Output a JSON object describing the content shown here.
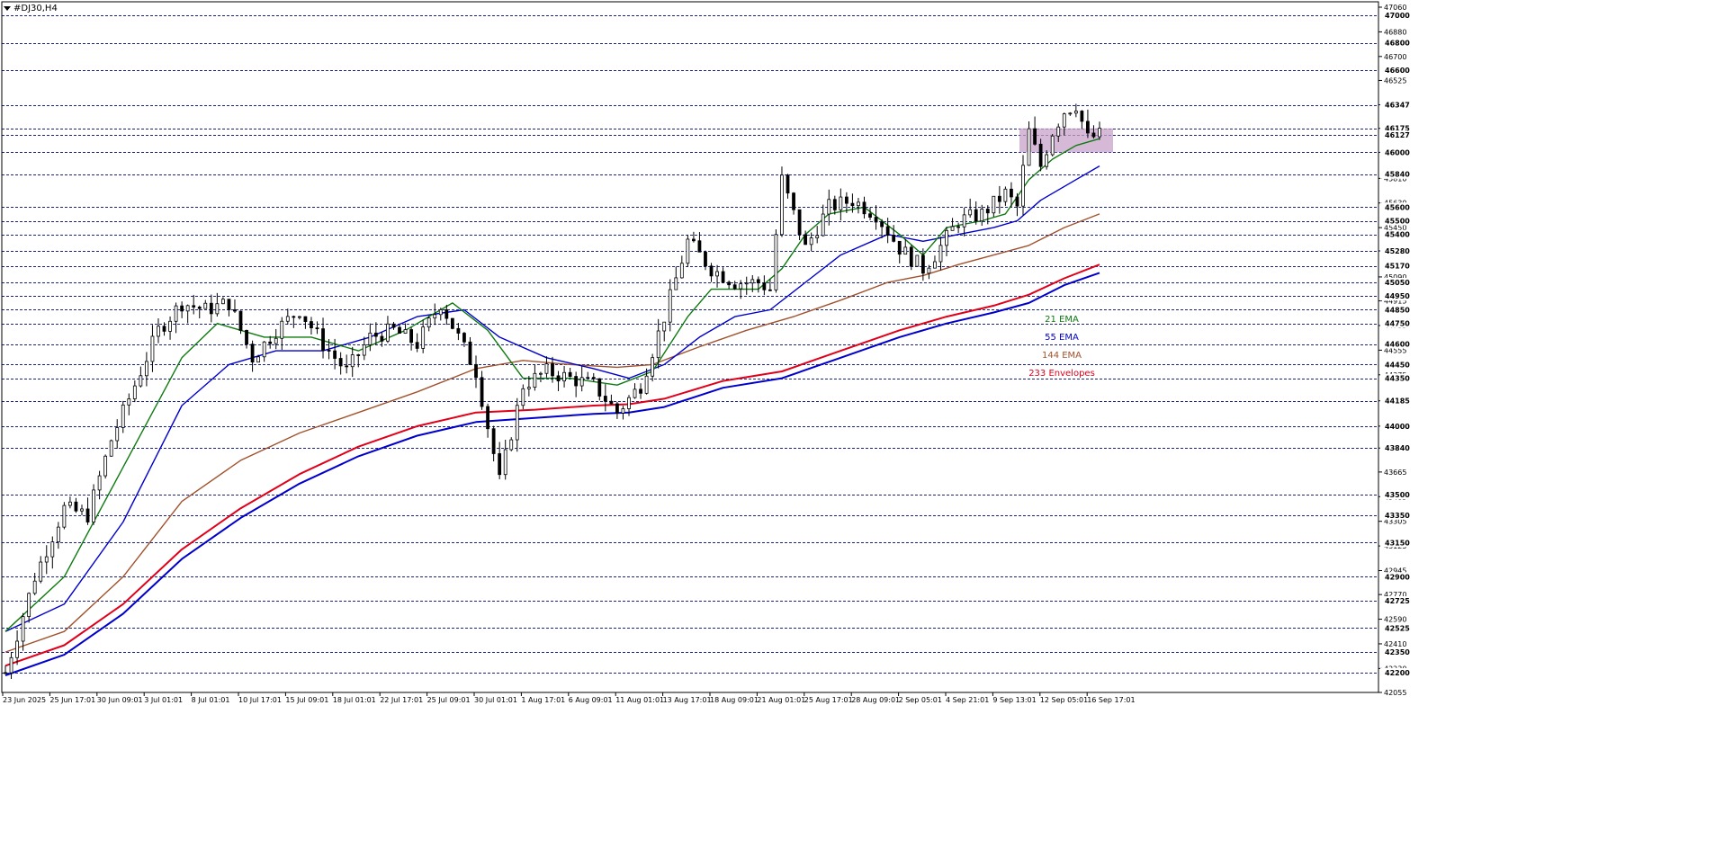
{
  "window": {
    "title": "#DJ30,H4"
  },
  "colors": {
    "ema21": "#0f7a0f",
    "ema55": "#0000cc",
    "ema144": "#a0522d",
    "envelope_upper": "#e0001a",
    "envelope_lower": "#0000cc",
    "grid": "#1a237e",
    "candle": "#000000",
    "highlight": "#c8a2c8"
  },
  "chart_data": {
    "type": "line",
    "symbol": "#DJ30",
    "timeframe": "H4",
    "title": "#DJ30,H4",
    "ylim": [
      42055,
      47060
    ],
    "y_tick_labels": [
      "47060",
      "46880",
      "46700",
      "46525",
      "46347",
      "46175",
      "46000",
      "45810",
      "45630",
      "45450",
      "45280",
      "45090",
      "44915",
      "44735",
      "44555",
      "44375",
      "44185",
      "44000",
      "43840",
      "43665",
      "43485",
      "43305",
      "43125",
      "42945",
      "42770",
      "42590",
      "42410",
      "42230",
      "42055"
    ],
    "price_levels": [
      47000,
      46800,
      46600,
      46347,
      46175,
      46127,
      46000,
      45840,
      45600,
      45500,
      45400,
      45280,
      45170,
      45050,
      44950,
      44850,
      44750,
      44600,
      44450,
      44350,
      44185,
      44000,
      43840,
      43500,
      43350,
      43150,
      42900,
      42725,
      42525,
      42350,
      42200
    ],
    "highlighted_levels": [
      "46175",
      "46127",
      "46000"
    ],
    "current_price": "46127",
    "x_tick_labels": [
      "23 Jun 2025",
      "25 Jun 17:01",
      "30 Jun 09:01",
      "3 Jul 01:01",
      "8 Jul 01:01",
      "10 Jul 17:01",
      "15 Jul 09:01",
      "18 Jul 01:01",
      "22 Jul 17:01",
      "25 Jul 09:01",
      "30 Jul 01:01",
      "1 Aug 17:01",
      "6 Aug 09:01",
      "11 Aug 01:01",
      "13 Aug 17:01",
      "18 Aug 09:01",
      "21 Aug 01:01",
      "25 Aug 17:01",
      "28 Aug 09:01",
      "2 Sep 05:01",
      "4 Sep 21:01",
      "9 Sep 13:01",
      "12 Sep 05:01",
      "16 Sep 17:01"
    ],
    "legend": [
      {
        "name": "21 EMA",
        "color": "#0f7a0f"
      },
      {
        "name": "55 EMA",
        "color": "#0000cc"
      },
      {
        "name": "144 EMA",
        "color": "#a0522d"
      },
      {
        "name": "233 Envelopes",
        "color": "#e0001a"
      }
    ],
    "zone": {
      "from_x": "12 Sep 05:01",
      "to_x": "16 Sep 17:01",
      "y_low": 46000,
      "y_high": 46175
    },
    "price_path": [
      [
        0,
        42200
      ],
      [
        5,
        42900
      ],
      [
        10,
        43400
      ],
      [
        14,
        43350
      ],
      [
        18,
        43900
      ],
      [
        22,
        44300
      ],
      [
        26,
        44700
      ],
      [
        30,
        44900
      ],
      [
        34,
        44850
      ],
      [
        38,
        44900
      ],
      [
        42,
        44500
      ],
      [
        46,
        44700
      ],
      [
        50,
        44850
      ],
      [
        54,
        44600
      ],
      [
        58,
        44400
      ],
      [
        62,
        44650
      ],
      [
        66,
        44700
      ],
      [
        70,
        44600
      ],
      [
        74,
        44900
      ],
      [
        80,
        44400
      ],
      [
        84,
        43600
      ],
      [
        88,
        44300
      ],
      [
        92,
        44400
      ],
      [
        96,
        44350
      ],
      [
        100,
        44300
      ],
      [
        104,
        44100
      ],
      [
        108,
        44300
      ],
      [
        112,
        44800
      ],
      [
        116,
        45350
      ],
      [
        120,
        45150
      ],
      [
        124,
        45050
      ],
      [
        128,
        45050
      ],
      [
        130,
        45000
      ],
      [
        132,
        45800
      ],
      [
        136,
        45300
      ],
      [
        140,
        45600
      ],
      [
        144,
        45650
      ],
      [
        148,
        45550
      ],
      [
        152,
        45300
      ],
      [
        156,
        45150
      ],
      [
        158,
        45250
      ],
      [
        162,
        45500
      ],
      [
        166,
        45550
      ],
      [
        170,
        45700
      ],
      [
        172,
        45600
      ],
      [
        174,
        46150
      ],
      [
        176,
        45900
      ],
      [
        178,
        46150
      ],
      [
        180,
        46300
      ],
      [
        182,
        46350
      ],
      [
        184,
        46100
      ],
      [
        186,
        46127
      ]
    ],
    "ema21": [
      [
        0,
        42500
      ],
      [
        10,
        42900
      ],
      [
        20,
        43700
      ],
      [
        30,
        44500
      ],
      [
        36,
        44750
      ],
      [
        44,
        44650
      ],
      [
        52,
        44650
      ],
      [
        60,
        44550
      ],
      [
        68,
        44700
      ],
      [
        76,
        44900
      ],
      [
        82,
        44700
      ],
      [
        88,
        44350
      ],
      [
        96,
        44350
      ],
      [
        104,
        44300
      ],
      [
        110,
        44400
      ],
      [
        116,
        44800
      ],
      [
        120,
        45000
      ],
      [
        128,
        45000
      ],
      [
        132,
        45150
      ],
      [
        136,
        45400
      ],
      [
        140,
        45550
      ],
      [
        146,
        45600
      ],
      [
        152,
        45400
      ],
      [
        156,
        45250
      ],
      [
        160,
        45450
      ],
      [
        166,
        45500
      ],
      [
        170,
        45550
      ],
      [
        174,
        45800
      ],
      [
        178,
        45950
      ],
      [
        182,
        46050
      ],
      [
        186,
        46100
      ]
    ],
    "ema55": [
      [
        0,
        42500
      ],
      [
        10,
        42700
      ],
      [
        20,
        43300
      ],
      [
        30,
        44150
      ],
      [
        38,
        44450
      ],
      [
        46,
        44550
      ],
      [
        54,
        44550
      ],
      [
        62,
        44650
      ],
      [
        70,
        44800
      ],
      [
        78,
        44850
      ],
      [
        84,
        44650
      ],
      [
        92,
        44500
      ],
      [
        100,
        44420
      ],
      [
        106,
        44350
      ],
      [
        112,
        44450
      ],
      [
        118,
        44650
      ],
      [
        124,
        44800
      ],
      [
        130,
        44850
      ],
      [
        136,
        45050
      ],
      [
        142,
        45250
      ],
      [
        150,
        45400
      ],
      [
        156,
        45350
      ],
      [
        162,
        45400
      ],
      [
        168,
        45450
      ],
      [
        172,
        45500
      ],
      [
        176,
        45650
      ],
      [
        182,
        45800
      ],
      [
        186,
        45900
      ]
    ],
    "ema144": [
      [
        0,
        42350
      ],
      [
        10,
        42500
      ],
      [
        20,
        42900
      ],
      [
        30,
        43450
      ],
      [
        40,
        43750
      ],
      [
        50,
        43950
      ],
      [
        60,
        44100
      ],
      [
        70,
        44250
      ],
      [
        80,
        44420
      ],
      [
        88,
        44480
      ],
      [
        96,
        44450
      ],
      [
        104,
        44430
      ],
      [
        110,
        44450
      ],
      [
        118,
        44580
      ],
      [
        126,
        44700
      ],
      [
        134,
        44800
      ],
      [
        142,
        44920
      ],
      [
        150,
        45050
      ],
      [
        156,
        45100
      ],
      [
        162,
        45180
      ],
      [
        168,
        45250
      ],
      [
        174,
        45320
      ],
      [
        180,
        45450
      ],
      [
        186,
        45550
      ]
    ],
    "envelope_upper": [
      [
        0,
        42250
      ],
      [
        10,
        42400
      ],
      [
        20,
        42700
      ],
      [
        30,
        43100
      ],
      [
        40,
        43400
      ],
      [
        50,
        43650
      ],
      [
        60,
        43850
      ],
      [
        70,
        44000
      ],
      [
        80,
        44100
      ],
      [
        90,
        44120
      ],
      [
        100,
        44150
      ],
      [
        106,
        44160
      ],
      [
        112,
        44200
      ],
      [
        122,
        44330
      ],
      [
        132,
        44400
      ],
      [
        142,
        44550
      ],
      [
        152,
        44700
      ],
      [
        160,
        44800
      ],
      [
        168,
        44880
      ],
      [
        174,
        44960
      ],
      [
        180,
        45080
      ],
      [
        186,
        45180
      ]
    ],
    "envelope_lower": [
      [
        0,
        42180
      ],
      [
        10,
        42330
      ],
      [
        20,
        42630
      ],
      [
        30,
        43030
      ],
      [
        40,
        43330
      ],
      [
        50,
        43580
      ],
      [
        60,
        43780
      ],
      [
        70,
        43930
      ],
      [
        80,
        44030
      ],
      [
        90,
        44060
      ],
      [
        100,
        44090
      ],
      [
        106,
        44100
      ],
      [
        112,
        44140
      ],
      [
        122,
        44280
      ],
      [
        132,
        44350
      ],
      [
        142,
        44500
      ],
      [
        152,
        44650
      ],
      [
        160,
        44750
      ],
      [
        168,
        44830
      ],
      [
        174,
        44900
      ],
      [
        180,
        45030
      ],
      [
        186,
        45120
      ]
    ]
  }
}
